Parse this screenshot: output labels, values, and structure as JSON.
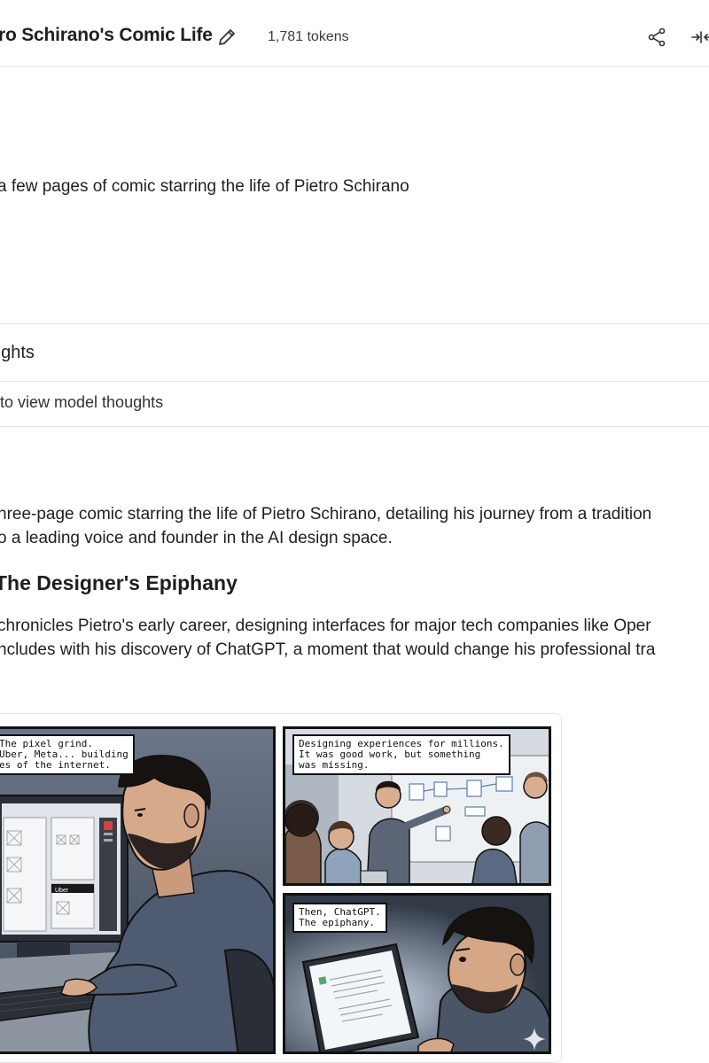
{
  "header": {
    "title": "ro Schirano's Comic Life",
    "tokens": "1,781 tokens"
  },
  "prompt": {
    "text": "a few pages of comic starring the life of Pietro Schirano"
  },
  "thoughts": {
    "title": "ughts",
    "expand_label": "to view model thoughts"
  },
  "response": {
    "intro_line1": "hree-page comic starring the life of Pietro Schirano, detailing his journey from a tradition",
    "intro_line2": "o a leading voice and founder in the AI design space.",
    "heading": "The Designer's Epiphany",
    "body_line1": "chronicles Pietro's early career, designing interfaces for major tech companies like Oper",
    "body_line2": "ncludes with his discovery of ChatGPT, a moment that would change his professional tra"
  },
  "comic": {
    "caption1": "The pixel grind.\nUber, Meta... building\nes of the internet.",
    "caption2": "Designing experiences for millions.\nIt was good work, but something\nwas missing.",
    "caption3": "Then, ChatGPT.\nThe epiphany.",
    "screen_label": "Uber"
  },
  "icons": {
    "edit": "pencil-icon",
    "share": "share-icon",
    "collapse": "collapse-arrows-icon",
    "sparkle": "sparkle-icon"
  }
}
